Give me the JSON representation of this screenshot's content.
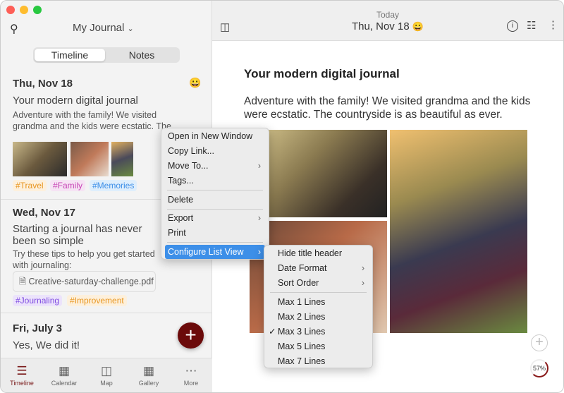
{
  "sidebar": {
    "journal_name": "My Journal",
    "tabs": [
      "Timeline",
      "Notes"
    ],
    "entries": [
      {
        "date": "Thu, Nov 18",
        "mood": "😀",
        "title": "Your modern digital journal",
        "body": "Adventure with the family! We visited grandma and the kids were ecstatic. The countryside is",
        "tags": [
          "#Travel",
          "#Family",
          "#Memories"
        ]
      },
      {
        "date": "Wed, Nov 17",
        "title": "Starting a journal has never been so simple",
        "body": "Try these tips to help you get started with journaling:",
        "attachment": "Creative-saturday-challenge.pdf",
        "tags": [
          "#Journaling",
          "#Improvement"
        ]
      },
      {
        "date": "Fri, July 3",
        "title": "Yes, We did it!"
      }
    ]
  },
  "tabbar": [
    {
      "label": "Timeline",
      "icon": "list-icon"
    },
    {
      "label": "Calendar",
      "icon": "calendar-icon"
    },
    {
      "label": "Map",
      "icon": "map-icon"
    },
    {
      "label": "Gallery",
      "icon": "grid-icon"
    },
    {
      "label": "More",
      "icon": "more-icon"
    }
  ],
  "header": {
    "today": "Today",
    "date": "Thu, Nov 18",
    "mood": "😀"
  },
  "editor": {
    "title": "Your modern digital journal",
    "body": "Adventure with the family! We visited grandma and the kids were ecstatic. The countryside is as beautiful as ever.",
    "progress": "57%"
  },
  "context_menu": [
    "Open in New Window",
    "Copy Link...",
    "Move To...",
    "Tags...",
    "Delete",
    "Export",
    "Print",
    "Configure List View"
  ],
  "submenu": [
    "Hide title header",
    "Date Format",
    "Sort Order",
    "Max 1 Lines",
    "Max 2 Lines",
    "Max 3 Lines",
    "Max 5 Lines",
    "Max 7 Lines"
  ],
  "submenu_checked": "Max 3 Lines",
  "colors": {
    "accent": "#6b0a0a",
    "highlight": "#3d8fe8"
  }
}
